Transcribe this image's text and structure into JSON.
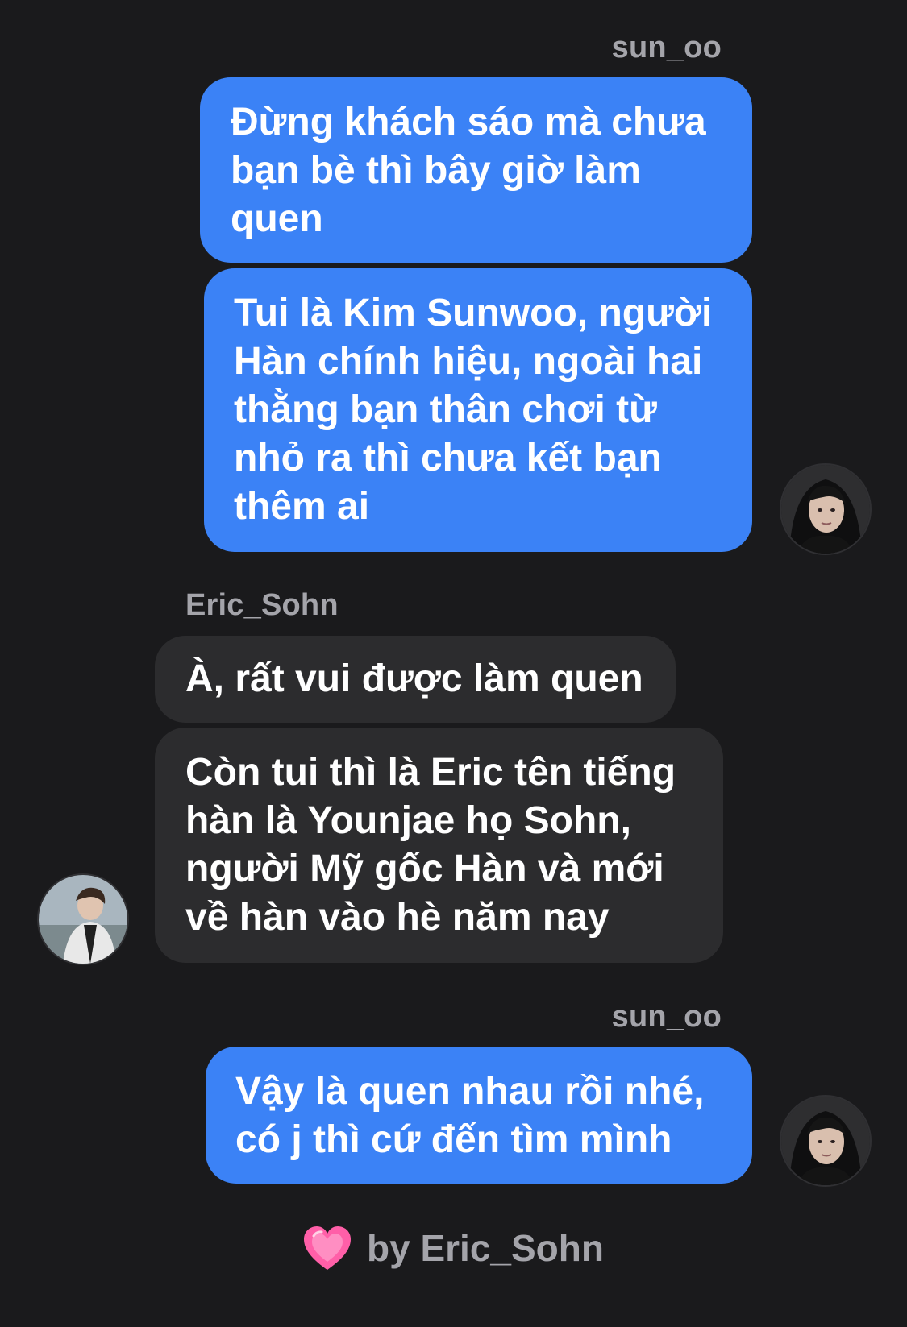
{
  "messages": [
    {
      "sender": "sun_oo",
      "text": "Đừng khách sáo mà chưa bạn bè thì bây giờ làm quen"
    },
    {
      "sender": "sun_oo",
      "text": "Tui là Kim Sunwoo, người Hàn chính hiệu, ngoài hai thằng bạn thân chơi từ nhỏ ra thì chưa kết bạn thêm ai"
    },
    {
      "sender": "Eric_Sohn",
      "text": "À, rất vui được làm quen"
    },
    {
      "sender": "Eric_Sohn",
      "text": "Còn tui thì là Eric tên tiếng hàn là Younjae họ Sohn, người Mỹ gốc Hàn và mới về hàn vào hè năm nay"
    },
    {
      "sender": "sun_oo",
      "text": "Vậy là quen nhau rồi nhé, có j thì cứ đến tìm mình"
    }
  ],
  "footer": {
    "icon": "pink-heart-icon",
    "text": "by Eric_Sohn"
  },
  "colors": {
    "background": "#1a1a1c",
    "outgoing_bubble": "#3b82f6",
    "incoming_bubble": "#2c2c2e",
    "name": "#a4a4aa",
    "heart": "#ff5fa8"
  }
}
